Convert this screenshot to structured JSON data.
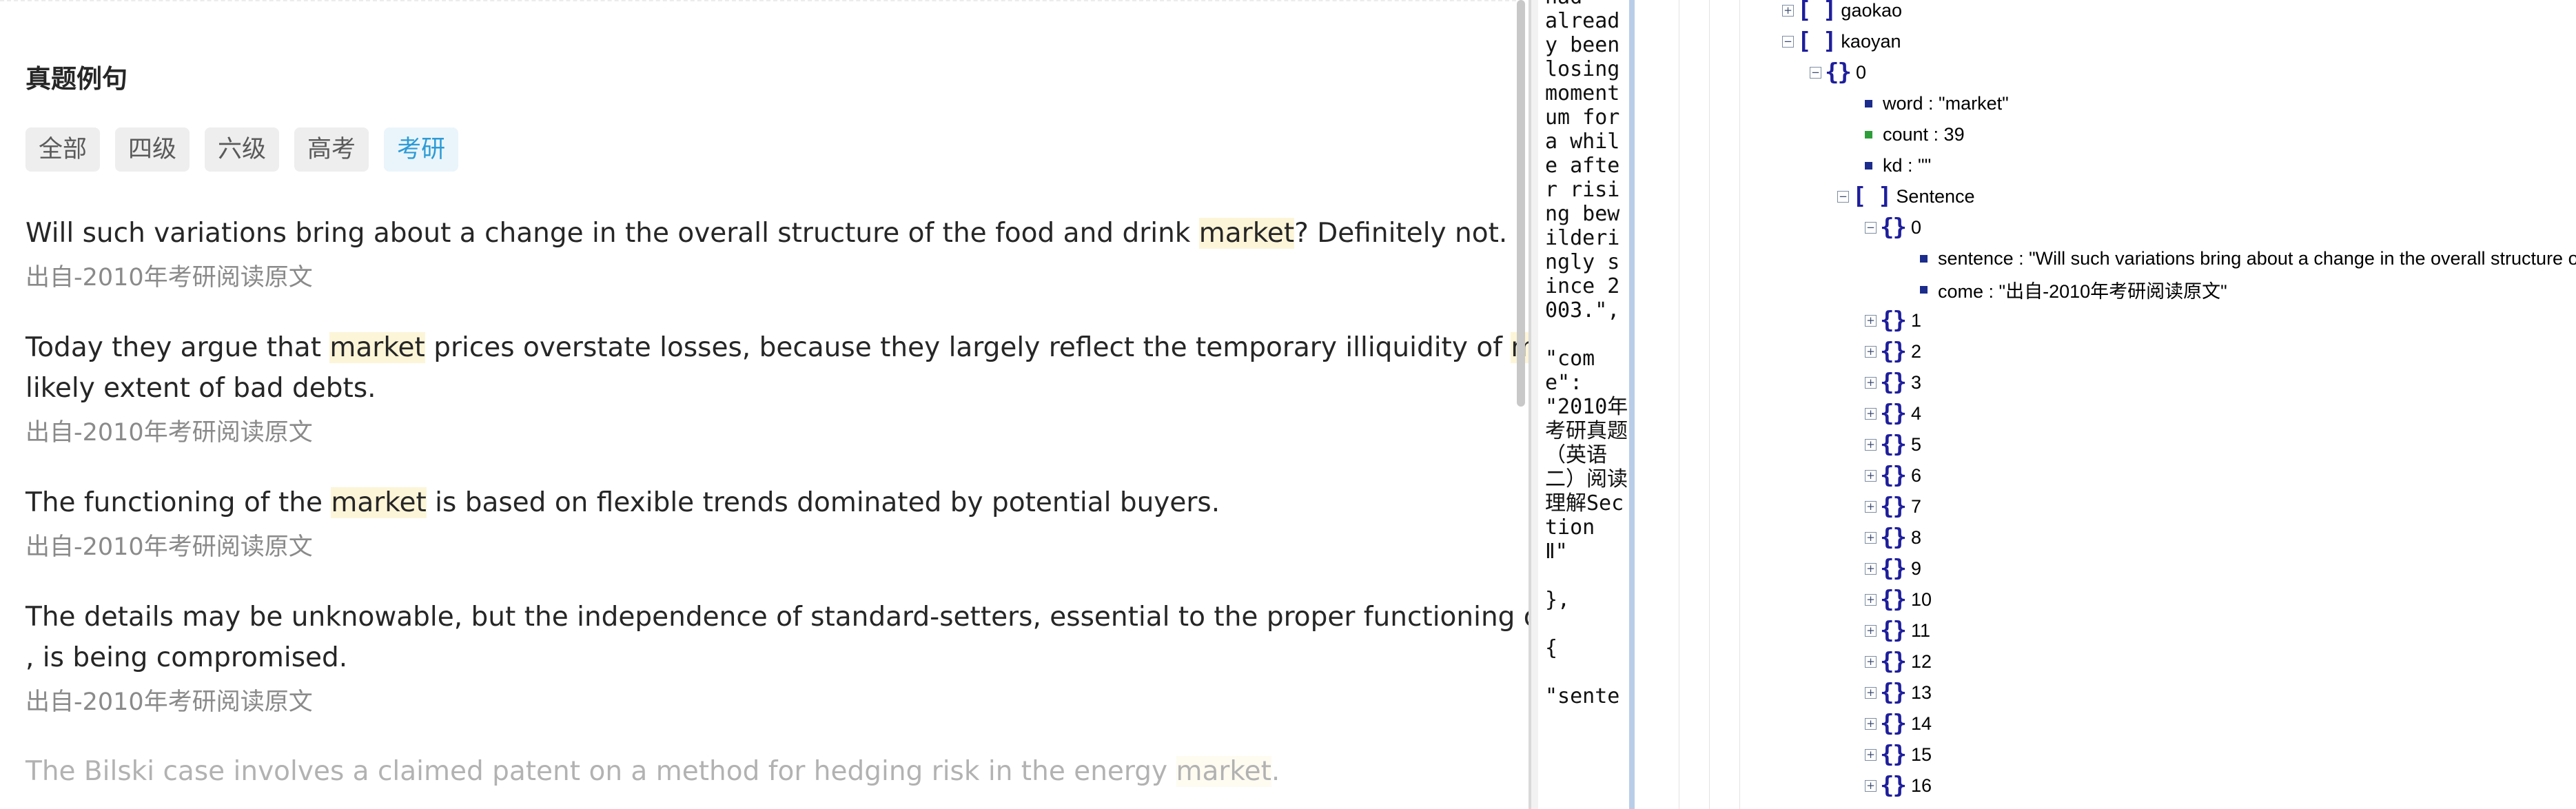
{
  "section": {
    "title": "真题例句",
    "tabs": [
      "全部",
      "四级",
      "六级",
      "高考",
      "考研"
    ],
    "active_tab": "考研"
  },
  "examples": [
    {
      "parts": [
        "Will such variations bring about a change in the overall structure of the food and drink ",
        "market",
        "? Definitely not."
      ],
      "source": "出自-2010年考研阅读原文"
    },
    {
      "parts": [
        "Today they argue that ",
        "market",
        " prices overstate losses, because they largely reflect the temporary illiquidity of ",
        "mark"
      ],
      "line2": "likely extent of bad debts.",
      "source": "出自-2010年考研阅读原文"
    },
    {
      "parts": [
        "The functioning of the ",
        "market",
        " is based on flexible trends dominated by potential buyers."
      ],
      "source": "出自-2010年考研阅读原文"
    },
    {
      "parts": [
        "The details may be unknowable, but the independence of standard-setters, essential to the proper functioning of c"
      ],
      "line2": ", is being compromised.",
      "source": "出自-2010年考研阅读原文"
    },
    {
      "parts": [
        "The Bilski case involves a claimed patent on a method for hedging risk in the energy ",
        "market",
        "."
      ],
      "source": ""
    }
  ],
  "raw_json_text": "had\nalready been losing momentum for a while after rising bewilderingly since 2003.\",\n\n\"come\":\n\"2010年考研真题（英语二）阅读理解Section Ⅱ\"\n\n},\n\n{\n\n\"sente",
  "tree": {
    "gaokao_label": "gaokao",
    "kaoyan_label": "kaoyan",
    "item0_index": "0",
    "word_row": "word : \"market\"",
    "count_row": "count : 39",
    "kd_row": "kd : \"\"",
    "sentence_label": "Sentence",
    "sentence0_index": "0",
    "sentence_row": "sentence : \"Will such variations bring about a change in the overall structure of the food and drink market? Definitely not.\"",
    "come_row": "come : \"出自-2010年考研阅读原文\"",
    "collapsed_indexes": [
      "1",
      "2",
      "3",
      "4",
      "5",
      "6",
      "7",
      "8",
      "9",
      "10",
      "11",
      "12",
      "13",
      "14",
      "15",
      "16"
    ]
  }
}
